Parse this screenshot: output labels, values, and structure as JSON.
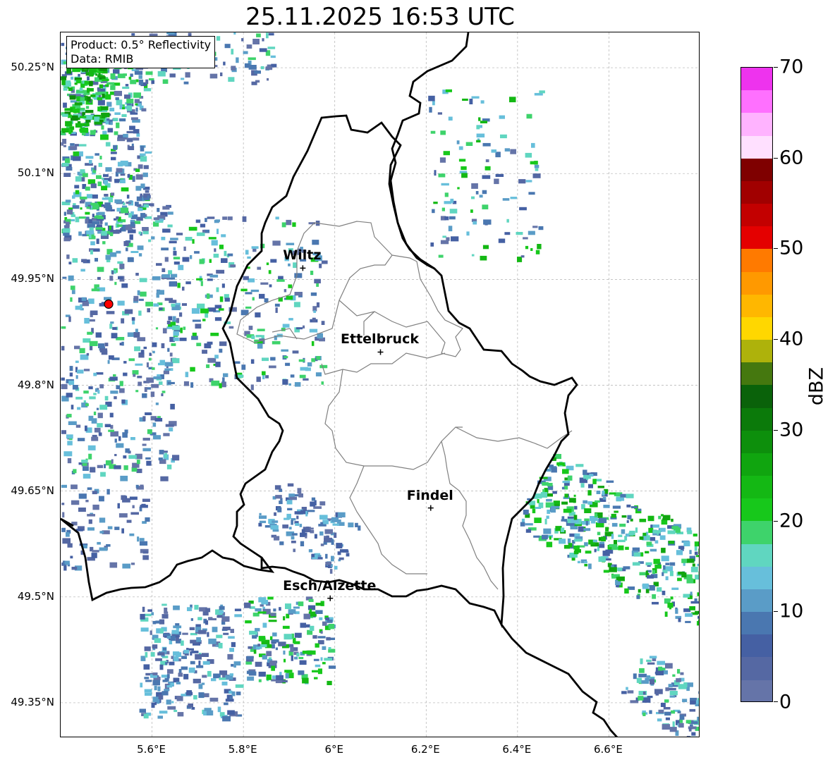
{
  "title": "25.11.2025 16:53 UTC",
  "info_box": {
    "line1": "Product: 0.5° Reflectivity",
    "line2": "Data: RMIB"
  },
  "map_extent": {
    "lon_min": 5.4,
    "lon_max": 6.8,
    "lat_min": 49.3,
    "lat_max": 50.3
  },
  "lat_ticks": [
    {
      "value": 50.25,
      "label": "50.25°N"
    },
    {
      "value": 50.1,
      "label": "50.1°N"
    },
    {
      "value": 49.95,
      "label": "49.95°N"
    },
    {
      "value": 49.8,
      "label": "49.8°N"
    },
    {
      "value": 49.65,
      "label": "49.65°N"
    },
    {
      "value": 49.5,
      "label": "49.5°N"
    },
    {
      "value": 49.35,
      "label": "49.35°N"
    }
  ],
  "lon_ticks": [
    {
      "value": 5.6,
      "label": "5.6°E"
    },
    {
      "value": 5.8,
      "label": "5.8°E"
    },
    {
      "value": 6.0,
      "label": "6°E"
    },
    {
      "value": 6.2,
      "label": "6.2°E"
    },
    {
      "value": 6.4,
      "label": "6.4°E"
    },
    {
      "value": 6.6,
      "label": "6.6°E"
    }
  ],
  "radar_site": {
    "lon": 5.505,
    "lat": 49.915,
    "color": "#ff0000"
  },
  "towns": [
    {
      "name": "Wiltz",
      "lon": 5.93,
      "lat": 49.966
    },
    {
      "name": "Ettelbruck",
      "lon": 6.1,
      "lat": 49.847
    },
    {
      "name": "Findel",
      "lon": 6.21,
      "lat": 49.626
    },
    {
      "name": "Esch/Alzette",
      "lon": 5.99,
      "lat": 49.498
    }
  ],
  "colorbar": {
    "label": "dBZ",
    "min": 0,
    "max": 70,
    "ticks": [
      0,
      10,
      20,
      30,
      40,
      50,
      60,
      70
    ],
    "colors": [
      "#6574a8",
      "#5568a3",
      "#4560a3",
      "#4a77b0",
      "#5a9cc7",
      "#67bfdb",
      "#60d6c0",
      "#3ed36b",
      "#17c81b",
      "#14b814",
      "#10a50f",
      "#0d8f0c",
      "#0b7a0a",
      "#0a620a",
      "#45780f",
      "#aeb20b",
      "#ffd700",
      "#ffb700",
      "#ff9900",
      "#ff7a00",
      "#e40000",
      "#c30000",
      "#a10000",
      "#7f0000",
      "#ffe0ff",
      "#ffb3ff",
      "#ff70ff",
      "#ee33ee"
    ]
  }
}
